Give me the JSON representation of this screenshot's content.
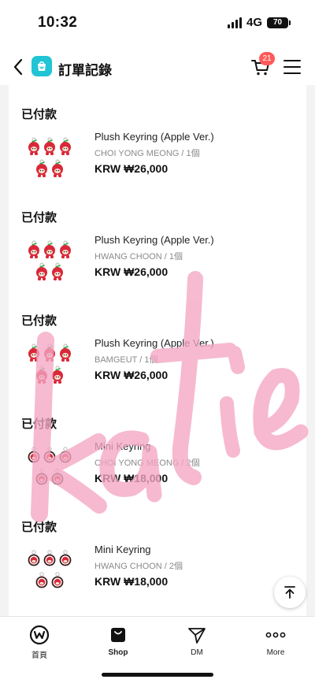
{
  "status_bar": {
    "time": "10:32",
    "network": "4G",
    "battery": "70"
  },
  "header": {
    "title": "訂單記錄",
    "cart_count": "21"
  },
  "orders": [
    {
      "status": "已付款",
      "name": "Plush Keyring (Apple Ver.)",
      "option": "CHOI YONG MEONG / 1個",
      "price": "KRW ₩26,000",
      "thumb": "plush-keyring-apple"
    },
    {
      "status": "已付款",
      "name": "Plush Keyring (Apple Ver.)",
      "option": "HWANG CHOON / 1個",
      "price": "KRW ₩26,000",
      "thumb": "plush-keyring-apple"
    },
    {
      "status": "已付款",
      "name": "Plush Keyring (Apple Ver.)",
      "option": "BAMGEUT / 1個",
      "price": "KRW ₩26,000",
      "thumb": "plush-keyring-apple"
    },
    {
      "status": "已付款",
      "name": "Mini Keyring",
      "option": "CHOI YONG MEONG / 2個",
      "price": "KRW ₩18,000",
      "thumb": "mini-keyring"
    },
    {
      "status": "已付款",
      "name": "Mini Keyring",
      "option": "HWANG CHOON / 2個",
      "price": "KRW ₩18,000",
      "thumb": "mini-keyring"
    }
  ],
  "watermark": {
    "text": "Katie",
    "color": "#f4a6c4"
  },
  "tabs": [
    {
      "label": "首頁",
      "icon": "weverse-logo-icon"
    },
    {
      "label": "Shop",
      "icon": "shopping-bag-icon"
    },
    {
      "label": "DM",
      "icon": "paper-plane-icon"
    },
    {
      "label": "More",
      "icon": "more-dots-icon"
    }
  ],
  "colors": {
    "accent": "#21c4d4",
    "badge": "#ff5a5a",
    "muted": "#8a8a8a"
  }
}
